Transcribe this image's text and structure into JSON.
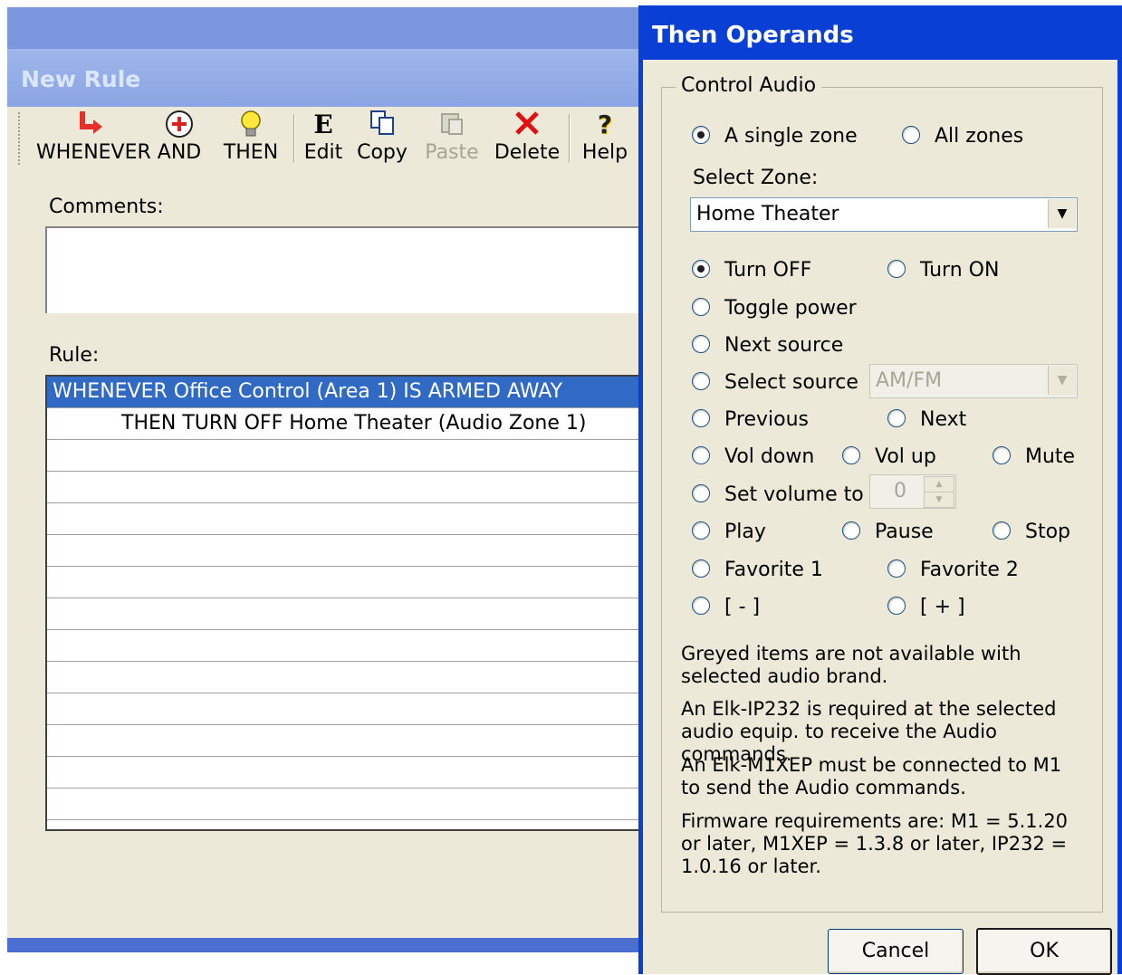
{
  "new_rule": {
    "title": "New Rule",
    "toolbar": {
      "whenever": "WHENEVER",
      "and": "AND",
      "then": "THEN",
      "edit": "Edit",
      "copy": "Copy",
      "paste": "Paste",
      "delete": "Delete",
      "help": "Help"
    },
    "comments_label": "Comments:",
    "comments_value": "",
    "rule_label": "Rule:",
    "rule_lines": [
      "WHENEVER  Office Control (Area 1) IS ARMED AWAY",
      "THEN TURN OFF Home Theater (Audio Zone 1)"
    ]
  },
  "dialog": {
    "title": "Then Operands",
    "group_caption": "Control Audio",
    "zone_mode": {
      "single": "A single zone",
      "all": "All zones",
      "selected": "single"
    },
    "select_zone_label": "Select Zone:",
    "zone_value": "Home Theater",
    "options": {
      "turn_off": "Turn OFF",
      "turn_on": "Turn ON",
      "toggle_power": "Toggle power",
      "next_source": "Next source",
      "select_source": "Select source",
      "previous": "Previous",
      "next": "Next",
      "vol_down": "Vol down",
      "vol_up": "Vol up",
      "mute": "Mute",
      "set_volume": "Set volume to",
      "play": "Play",
      "pause": "Pause",
      "stop": "Stop",
      "favorite1": "Favorite 1",
      "favorite2": "Favorite 2",
      "minus": "[ - ]",
      "plus": "[ + ]",
      "selected": "turn_off"
    },
    "source_value": "AM/FM",
    "volume_value": "0",
    "notes": [
      "Greyed items are not available with selected audio brand.",
      "An Elk-IP232 is required at the selected audio equip. to receive the Audio commands.",
      "An Elk-M1XEP must be connected to M1 to send the Audio commands.",
      "Firmware requirements are: M1 = 5.1.20 or later, M1XEP = 1.3.8 or later, IP232 = 1.0.16 or later."
    ],
    "cancel_label": "Cancel",
    "ok_label": "OK"
  },
  "colors": {
    "dialog_frame": "#0a3fd6",
    "selection": "#316ac5",
    "window_face": "#ece9d8",
    "whenever_arrow": "#e8302a",
    "delete_x": "#e01010"
  }
}
